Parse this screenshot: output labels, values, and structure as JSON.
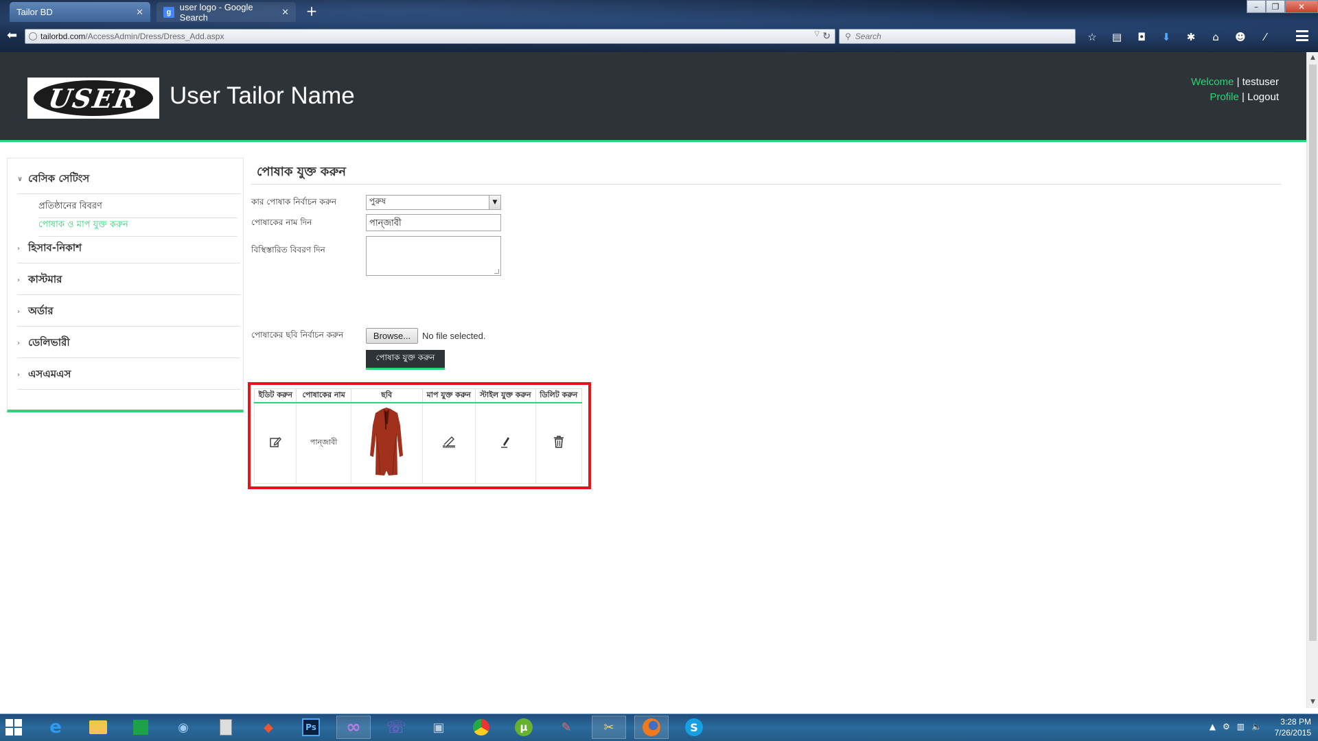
{
  "browser": {
    "tabs": [
      {
        "title": "Tailor BD",
        "active": true
      },
      {
        "title": "user logo - Google Search",
        "active": false
      }
    ],
    "new_tab": "+",
    "url_host": "tailorbd.com",
    "url_path": "/AccessAdmin/Dress/Dress_Add.aspx",
    "search_placeholder": "Search",
    "window_controls": {
      "minimize": "–",
      "restore": "❐",
      "close": "✕"
    }
  },
  "header": {
    "logo_text": "USER",
    "site_name": "User Tailor Name",
    "welcome_label": "Welcome",
    "username": "testuser",
    "profile_link": "Profile",
    "logout_link": "Logout",
    "separator": "|"
  },
  "sidebar": {
    "groups": [
      {
        "label": "বেসিক সেটিংস",
        "expanded": true,
        "items": [
          {
            "label": "প্রতিষ্ঠানের বিবরণ",
            "active": false
          },
          {
            "label": "পোষাক ও মাপ যুক্ত করুন",
            "active": true
          }
        ]
      },
      {
        "label": "হিসাব-নিকাশ",
        "expanded": false
      },
      {
        "label": "কাস্টমার",
        "expanded": false
      },
      {
        "label": "অর্ডার",
        "expanded": false
      },
      {
        "label": "ডেলিভারী",
        "expanded": false
      },
      {
        "label": "এসএমএস",
        "expanded": false
      }
    ]
  },
  "form": {
    "title": "পোষাক যুক্ত করুন",
    "gender_label": "কার পোষাক নির্বাচন করুন",
    "gender_value": "পুরুষ",
    "name_label": "পোষাকের নাম দিন",
    "name_value": "পান্জাবী",
    "desc_label": "বিস্থিস্তারিত বিবরণ দিন",
    "desc_value": "",
    "image_label": "পোষাকের ছবি নির্বাচন করুন",
    "browse_label": "Browse...",
    "no_file": "No file selected.",
    "submit_label": "পোষাক যুক্ত করুন"
  },
  "table": {
    "headers": [
      "ইডিট করুন",
      "পোষাকের নাম",
      "ছবি",
      "মাপ যুক্ত করুন",
      "স্টাইল যুক্ত করুন",
      "ডিলিট করুন"
    ],
    "rows": [
      {
        "name": "পান্জাবী",
        "edit_icon": "edit-icon",
        "image": "punjabi-photo",
        "measure_icon": "measure-tape-icon",
        "style_icon": "pen-style-icon",
        "delete_icon": "trash-icon"
      }
    ]
  },
  "taskbar": {
    "apps": [
      "ie",
      "file-explorer",
      "store",
      "remote-desktop",
      "calculator",
      "app-red",
      "photoshop",
      "visual-studio",
      "viber",
      "network-app",
      "chrome",
      "utorrent",
      "paint",
      "tools",
      "firefox",
      "skype"
    ],
    "time": "3:28 PM",
    "date": "7/26/2015"
  },
  "colors": {
    "header_bg": "#2e3338",
    "accent_green": "#2bd478",
    "highlight_red": "#e8131a"
  }
}
